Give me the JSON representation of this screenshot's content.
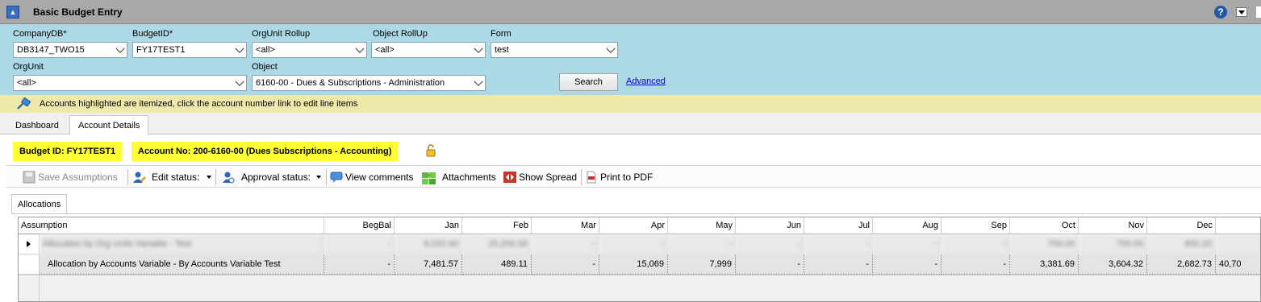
{
  "window": {
    "title": "Basic Budget Entry"
  },
  "filters": {
    "company_db": {
      "label": "CompanyDB*",
      "value": "DB3147_TWO15"
    },
    "budget_id": {
      "label": "BudgetID*",
      "value": "FY17TEST1"
    },
    "orgunit_rollup": {
      "label": "OrgUnit Rollup",
      "value": "<all>"
    },
    "object_rollup": {
      "label": "Object RollUp",
      "value": "<all>"
    },
    "form": {
      "label": "Form",
      "value": "test"
    },
    "orgunit": {
      "label": "OrgUnit",
      "value": "<all>"
    },
    "object": {
      "label": "Object",
      "value": "6160-00 - Dues & Subscriptions - Administration"
    },
    "search_label": "Search",
    "advanced_label": "Advanced"
  },
  "notice": {
    "text": "Accounts highlighted are itemized, click the account number link to edit line items"
  },
  "tabs": [
    {
      "label": "Dashboard"
    },
    {
      "label": "Account Details"
    }
  ],
  "chips": {
    "budget": "Budget ID: FY17TEST1",
    "account": "Account No: 200-6160-00 (Dues  Subscriptions - Accounting)"
  },
  "toolbar": {
    "save": "Save Assumptions",
    "edit_status": "Edit status:",
    "approval_status": "Approval status:",
    "view_comments": "View comments",
    "attachments": "Attachments",
    "show_spread": "Show Spread",
    "print_pdf": "Print to PDF"
  },
  "subtab": "Allocations",
  "grid": {
    "columns": [
      "Assumption",
      "BegBal",
      "Jan",
      "Feb",
      "Mar",
      "Apr",
      "May",
      "Jun",
      "Jul",
      "Aug",
      "Sep",
      "Oct",
      "Nov",
      "Dec"
    ],
    "rows": [
      {
        "assumption": "Allocation by  Org Units Variable - Test",
        "values": [
          "-",
          "9,032.00",
          "25,200.00",
          "-",
          "-",
          "-",
          "-",
          "-",
          "-",
          "-",
          "759.00",
          "759.00",
          "800.20"
        ],
        "total": ""
      },
      {
        "assumption": "Allocation by  Accounts Variable - By Accounts Variable Test",
        "values": [
          "-",
          "7,481.57",
          "489.11",
          "-",
          "15,069",
          "7,999",
          "-",
          "-",
          "-",
          "-",
          "3,381.69",
          "3,604.32",
          "2,682.73"
        ],
        "total": "40,70"
      }
    ]
  },
  "colors": {
    "filter_bg": "#add8e6",
    "notice_bg": "#eee8aa",
    "highlight": "#ffff33",
    "titlebar": "#a8a8a8"
  }
}
